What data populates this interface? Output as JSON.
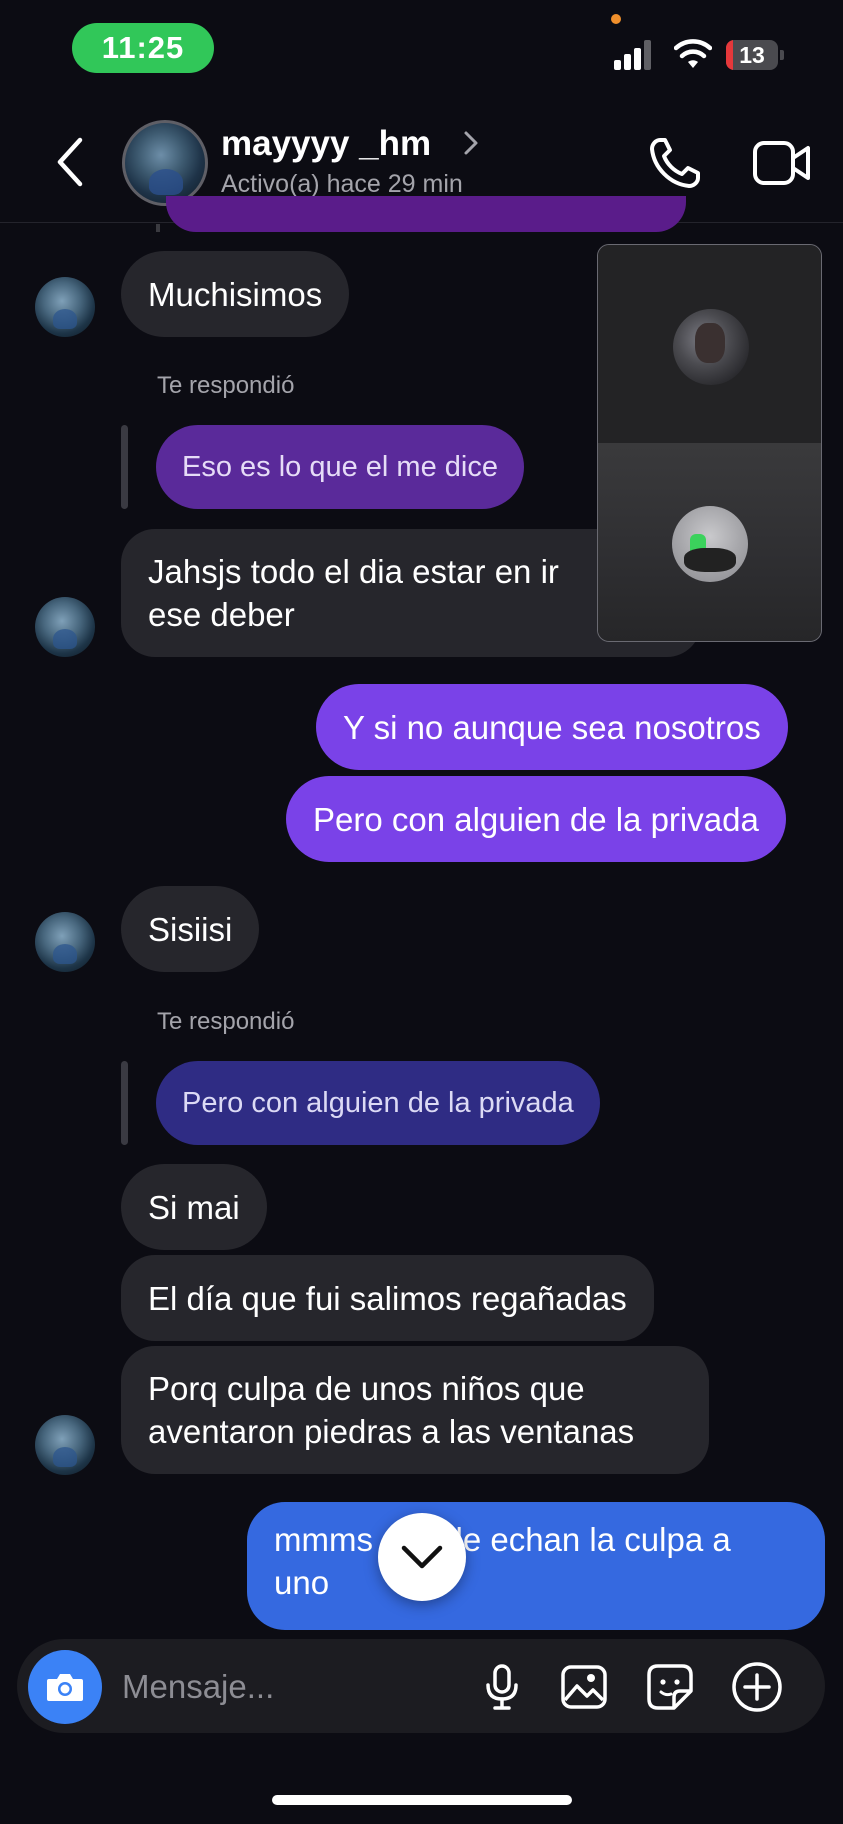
{
  "status_bar": {
    "time": "11:25",
    "battery_level": "13",
    "battery_fraction": 0.13,
    "battery_color": "#e5383b"
  },
  "header": {
    "username": "mayyyy _hm",
    "active_status": "Activo(a) hace 29 min",
    "icons": [
      "chevron-left-icon",
      "chevron-right-icon",
      "phone-icon",
      "video-camera-icon"
    ]
  },
  "messages": {
    "m1": "Muchisimos",
    "reply1_label": "Te respondió",
    "reply1_quote": "Eso es lo que el me dice",
    "m2_line1": "Jahsjs todo el dia estar en ir",
    "m2_line2": "ese deber",
    "out1": "Y si no aunque sea nosotros",
    "out2": "Pero con alguien de la privada",
    "m3": "Sisiisi",
    "reply2_label": "Te respondió",
    "reply2_quote": "Pero con alguien de la privada",
    "m4": "Si mai",
    "m5": "El día que fui salimos regañadas",
    "m6_line1": "Porq culpa de unos niños que",
    "m6_line2": "aventaron piedras a las ventanas",
    "out3_line1": "mmms      o le echan la culpa a",
    "out3_line2": "uno"
  },
  "composer": {
    "placeholder": "Mensaje...",
    "icons": [
      "camera-icon",
      "microphone-icon",
      "gallery-icon",
      "sticker-icon",
      "plus-circle-icon"
    ]
  },
  "colors": {
    "background": "#0c0c13",
    "incoming_bubble": "#26262c",
    "outgoing_bubble": "#7a42e8",
    "outgoing_latest": "#3569e0",
    "reply_quote_1": "#5a2a9a",
    "reply_quote_2": "#2f2c84",
    "active_pill": "#31c759"
  }
}
